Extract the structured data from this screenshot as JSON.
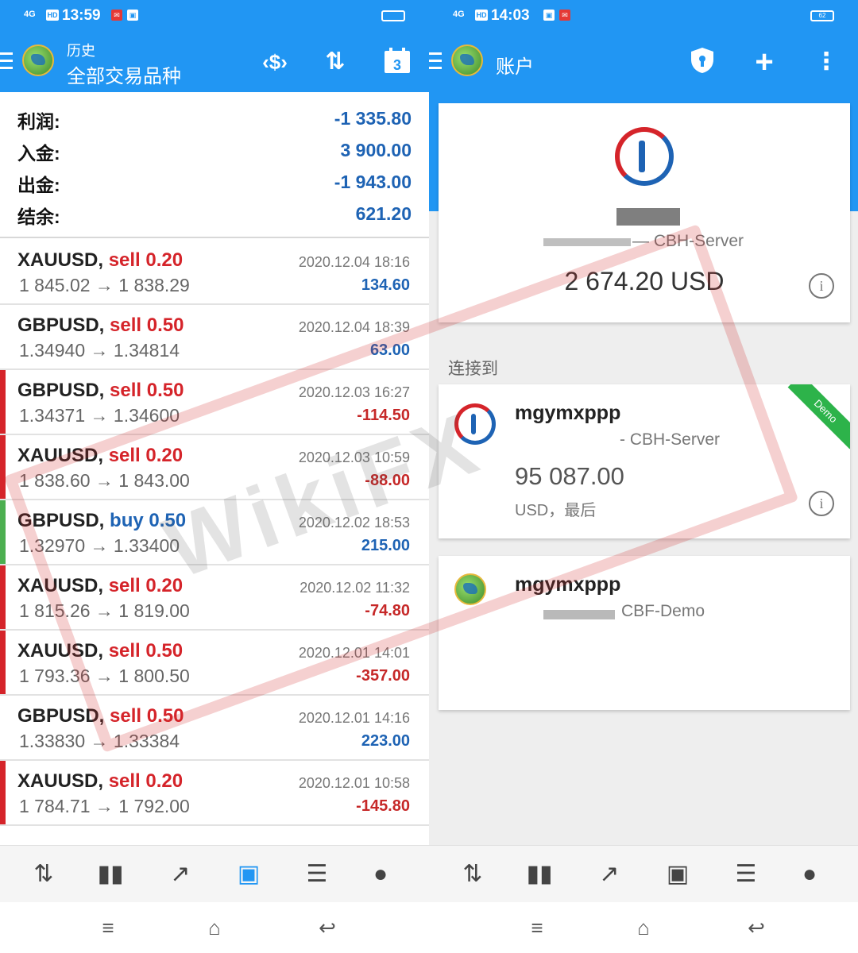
{
  "left": {
    "status": {
      "time": "13:59",
      "network": "4G",
      "hd": "HD"
    },
    "header": {
      "subtitle": "历史",
      "title": "全部交易品种",
      "calendar_day": "3"
    },
    "summary": [
      {
        "label": "利润:",
        "value": "-1 335.80"
      },
      {
        "label": "入金:",
        "value": "3 900.00"
      },
      {
        "label": "出金:",
        "value": "-1 943.00"
      },
      {
        "label": "结余:",
        "value": "621.20"
      }
    ],
    "trades": [
      {
        "symbol": "XAUUSD,",
        "side": "sell",
        "volume": "0.20",
        "prices": "1 845.02 → 1 838.29",
        "time": "2020.12.04 18:16",
        "profit": "134.60",
        "profit_color": "#1e63b4",
        "marker": ""
      },
      {
        "symbol": "GBPUSD,",
        "side": "sell",
        "volume": "0.50",
        "prices": "1.34940 → 1.34814",
        "time": "2020.12.04 18:39",
        "profit": "63.00",
        "profit_color": "#1e63b4",
        "marker": ""
      },
      {
        "symbol": "GBPUSD,",
        "side": "sell",
        "volume": "0.50",
        "prices": "1.34371 → 1.34600",
        "time": "2020.12.03 16:27",
        "profit": "-114.50",
        "profit_color": "#c62828",
        "marker": "#d5242a"
      },
      {
        "symbol": "XAUUSD,",
        "side": "sell",
        "volume": "0.20",
        "prices": "1 838.60 → 1 843.00",
        "time": "2020.12.03 10:59",
        "profit": "-88.00",
        "profit_color": "#c62828",
        "marker": "#d5242a"
      },
      {
        "symbol": "GBPUSD,",
        "side": "buy",
        "volume": "0.50",
        "prices": "1.32970 → 1.33400",
        "time": "2020.12.02 18:53",
        "profit": "215.00",
        "profit_color": "#1e63b4",
        "marker": "#4caf50"
      },
      {
        "symbol": "XAUUSD,",
        "side": "sell",
        "volume": "0.20",
        "prices": "1 815.26 → 1 819.00",
        "time": "2020.12.02 11:32",
        "profit": "-74.80",
        "profit_color": "#c62828",
        "marker": "#d5242a"
      },
      {
        "symbol": "XAUUSD,",
        "side": "sell",
        "volume": "0.50",
        "prices": "1 793.36 → 1 800.50",
        "time": "2020.12.01 14:01",
        "profit": "-357.00",
        "profit_color": "#c62828",
        "marker": "#d5242a"
      },
      {
        "symbol": "GBPUSD,",
        "side": "sell",
        "volume": "0.50",
        "prices": "1.33830 → 1.33384",
        "time": "2020.12.01 14:16",
        "profit": "223.00",
        "profit_color": "#1e63b4",
        "marker": ""
      },
      {
        "symbol": "XAUUSD,",
        "side": "sell",
        "volume": "0.20",
        "prices": "1 784.71 → 1 792.00",
        "time": "2020.12.01 10:58",
        "profit": "-145.80",
        "profit_color": "#c62828",
        "marker": "#d5242a"
      }
    ],
    "nav": [
      "quotes-icon",
      "chart-icon",
      "trade-icon",
      "history-icon",
      "news-icon",
      "chat-icon"
    ]
  },
  "right": {
    "status": {
      "time": "14:03",
      "network": "4G",
      "hd": "HD",
      "battery": "62"
    },
    "header": {
      "title": "账户"
    },
    "current_account": {
      "server": "CBH-Server",
      "balance": "2 674.20 USD"
    },
    "connected_label": "连接到",
    "accounts": [
      {
        "name": "mgymxppp",
        "server": "CBH-Server",
        "balance": "95 087.00",
        "currency": "USD，最后",
        "badge": "Demo"
      },
      {
        "name": "mgymxppp",
        "server": "CBF-Demo"
      }
    ]
  },
  "watermark": {
    "text": "WikiFX"
  },
  "colors": {
    "primary": "#2196f3",
    "profit_positive": "#1e63b4",
    "profit_negative": "#c62828",
    "sell": "#d5242a",
    "demo": "#2db34a"
  }
}
